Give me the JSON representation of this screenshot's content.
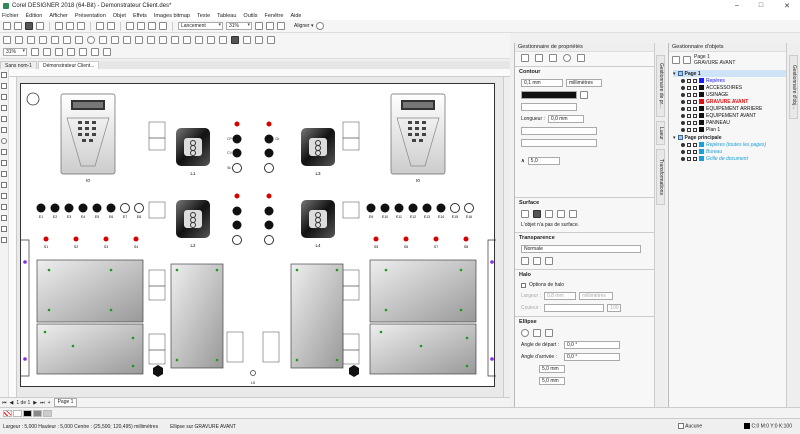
{
  "window": {
    "title": "Corel DESIGNER 2018 (64-Bit) - Demonstrateur Client.des*",
    "controls": [
      "–",
      "□",
      "✕"
    ]
  },
  "menu": [
    "Fichier",
    "Édition",
    "Afficher",
    "Présentation",
    "Objet",
    "Effets",
    "Images bitmap",
    "Texte",
    "Tableau",
    "Outils",
    "Fenêtre",
    "Aide"
  ],
  "toolbar": {
    "launch_label": "Lancement",
    "zoom": "31%",
    "align_label": "Aligner ▾"
  },
  "tools": {
    "zoom2": "31%"
  },
  "doc_tabs": [
    "Sans nom-1",
    "Démonstrateur Client..."
  ],
  "canvas_labels": {
    "i0_left": "I0",
    "i0_right": "I0",
    "l1": "L1",
    "l2": "L2",
    "l3": "L3",
    "l4": "L4",
    "l5": "L5",
    "e_row": [
      "E1",
      "E2",
      "E3",
      "E4",
      "E5",
      "E6",
      "E7",
      "E8"
    ],
    "e_row_right": [
      "E9",
      "E10",
      "E11",
      "E12",
      "E13",
      "E14",
      "E15",
      "E16"
    ],
    "s_row": [
      "S1",
      "S2",
      "S3",
      "S4",
      "S5",
      "S6",
      "S7",
      "S8"
    ],
    "cp": "CP",
    "cv": "CV",
    "ck": "Ck",
    "sk": "Sk"
  },
  "pagenav": {
    "page_of": "1 de 1",
    "page": "Page 1"
  },
  "status": {
    "dims": "Largeur : 5,000  Hauteur : 5,000  Centre : (25,500; 120,495)  millimètres",
    "selection": "Ellipse sur GRAVURE AVANT",
    "fill": "Aucune",
    "outline": "C:0 M:0 Y:0 K:100"
  },
  "props": {
    "title": "Gestionnaire de propriétés",
    "contour": "Contour",
    "width": "0,1 mm",
    "units": "millimètres",
    "length_label": "Longueur :",
    "length": "0,0 mm",
    "angle": "5,0",
    "surface": "Surface",
    "no_surface": "L'objet n'a pas de surface.",
    "transparence": "Transparence",
    "normal": "Normale",
    "halo": "Halo",
    "halo_options": "Options de halo",
    "halo_width_label": "Largeur :",
    "halo_width": "0,8 mm",
    "halo_units": "millimètres",
    "halo_color_label": "Couleur :",
    "halo_opacity": "100",
    "ellipse": "Ellipse",
    "start_label": "Angle de départ :",
    "start": "0,0 °",
    "end_label": "Angle d'arrivée :",
    "end": "0,0 °",
    "w5": "5,0 mm",
    "h5": "5,0 mm"
  },
  "vtabs_props": [
    "Gestionnaire de pr...",
    "Lueur",
    "Transformations"
  ],
  "objects": {
    "title": "Gestionnaire d'objets",
    "page_header": "Page 1",
    "layer_header": "GRAVURE AVANT",
    "page1": "Page 1",
    "layers": [
      {
        "name": "Repères",
        "color": "#1a1aff"
      },
      {
        "name": "ACCESSOIRES",
        "color": "#111"
      },
      {
        "name": "USINAGE",
        "color": "#111"
      },
      {
        "name": "GRAVURE AVANT",
        "color": "#e01010"
      },
      {
        "name": "EQUIPEMENT ARRIERE",
        "color": "#111"
      },
      {
        "name": "EQUIPEMENT AVANT",
        "color": "#111"
      },
      {
        "name": "PANNEAU",
        "color": "#111"
      },
      {
        "name": "Plan 1",
        "color": "#111"
      }
    ],
    "master": "Page principale",
    "master_layers": [
      {
        "name": "Repères (toutes les pages)",
        "color": "#1a9fd8"
      },
      {
        "name": "Bureau",
        "color": "#1a9fd8"
      },
      {
        "name": "Grille de document",
        "color": "#1a9fd8"
      }
    ]
  },
  "vtabs_objects": [
    "Gestionnaire d'obj..."
  ],
  "colors": {
    "accent_blue": "#1a1aff",
    "red_led": "#d80000",
    "green_dot": "#1a9a1a",
    "panel_bg": "#f7f7f7"
  }
}
